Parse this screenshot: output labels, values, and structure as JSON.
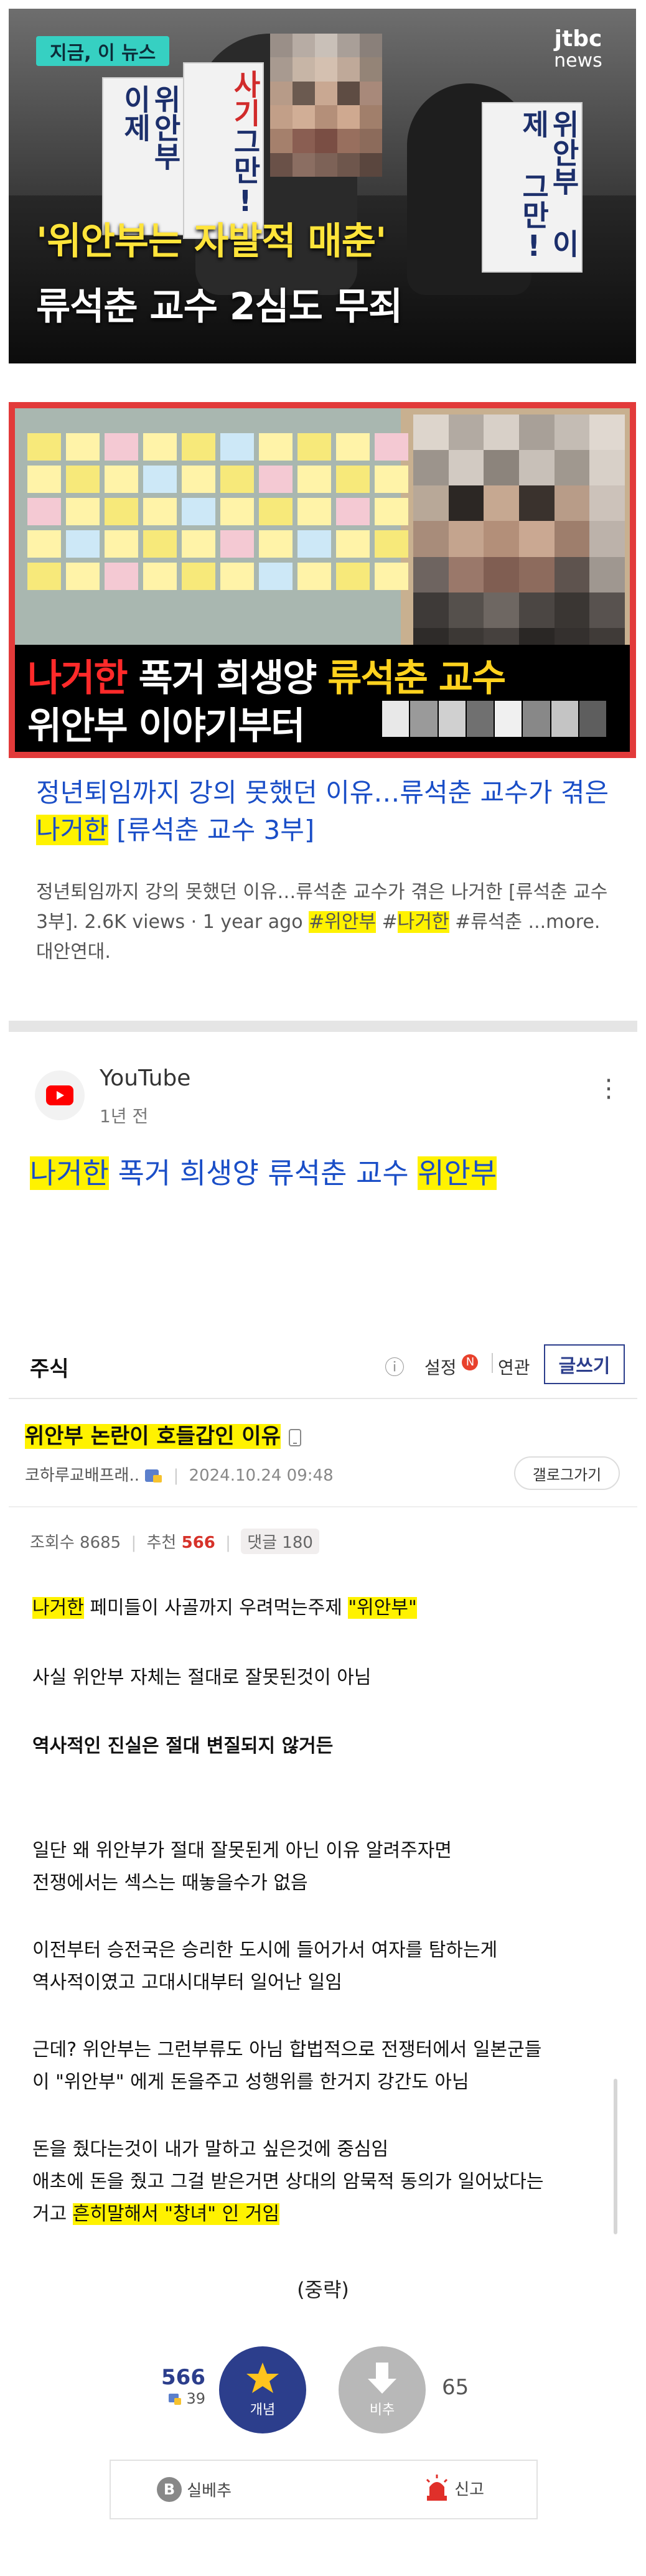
{
  "news1": {
    "badge": "지금, 이 뉴스",
    "logo_top": "jtbc",
    "logo_bottom": "news",
    "sign1": "위안부 이제",
    "sign_red": "사기",
    "sign2": "그만!",
    "sign3": "위안부 이제 그만!",
    "caption_line1": "'위안부는 자발적 매춘'",
    "caption_line2": "류석춘 교수 2심도 무죄"
  },
  "news2": {
    "caption_line1_a": "나거한",
    "caption_line1_b": "폭거 희생양",
    "caption_line1_c": "류석춘 교수",
    "caption_line2": "위안부 이야기부터"
  },
  "result": {
    "title_a": "정년퇴임까지 강의 못했던 이유…류석춘 교수가 겪은 ",
    "title_hl": "나거한",
    "title_b": " [류석춘 교수 3부]",
    "desc_a": "정년퇴임까지 강의 못했던 이유…류석춘 교수가 겪은 나거한 [류석춘 교수 3부]. 2.6K views · 1 year ago ",
    "desc_tag1": "#위안부",
    "desc_sp": " ",
    "desc_tag2_hash": "#",
    "desc_tag2": "나거한",
    "desc_b": " #류석춘 ...more. 대안연대."
  },
  "youtube": {
    "source": "YouTube",
    "time": "1년 전",
    "more": "⋮",
    "title_hl1": "나거한",
    "title_mid": " 폭거 희생양 류석춘 교수 ",
    "title_hl2": "위안부"
  },
  "forum": {
    "board": "주식",
    "info": "ⓘ",
    "settings": "설정",
    "settings_badge": "N",
    "connect": "연관",
    "write": "글쓰기",
    "post_title": "위안부 논란이 호들갑인 이유",
    "author": "코하루교배프래..",
    "date": "2024.10.24 09:48",
    "gallery": "갤로그가기",
    "views": "조회수 8685",
    "recommend_label": "추천 ",
    "recommend_count": "566",
    "comments": "댓글 180",
    "body": {
      "l1_hl1": "나거한",
      "l1_mid": " 페미들이 사골까지 우려먹는주제 ",
      "l1_hl2": "\"위안부\"",
      "l2": "사실 위안부 자체는 절대로 잘못된것이 아님",
      "l3": "역사적인 진실은 절대 변질되지 않거든",
      "l4": "일단 왜 위안부가 절대 잘못된게 아닌 이유 알려주자면",
      "l5": "전쟁에서는 섹스는 때놓을수가 없음",
      "l6": "이전부터 승전국은 승리한 도시에 들어가서 여자를 탐하는게",
      "l7": "역사적이였고 고대시대부터 일어난 일임",
      "l8": "근데? 위안부는 그런부류도 아님 합법적으로 전쟁터에서 일본군들",
      "l9": "이 \"위안부\" 에게 돈을주고 성행위를 한거지 강간도 아님",
      "l10": "돈을 줬다는것이 내가 말하고 싶은것에 중심임",
      "l11": "애초에 돈을 줬고 그걸 받은거면 상대의 암묵적 동의가 일어났다는",
      "l12_a": "거고 ",
      "l12_hl": "흔히말해서 \"창녀\" 인 거임",
      "l13": "(중략)"
    },
    "up_count": "566",
    "up_sub": "39",
    "up_label": "개념",
    "down_label": "비추",
    "down_count": "65",
    "share_label": "실베추",
    "report_label": "신고"
  }
}
